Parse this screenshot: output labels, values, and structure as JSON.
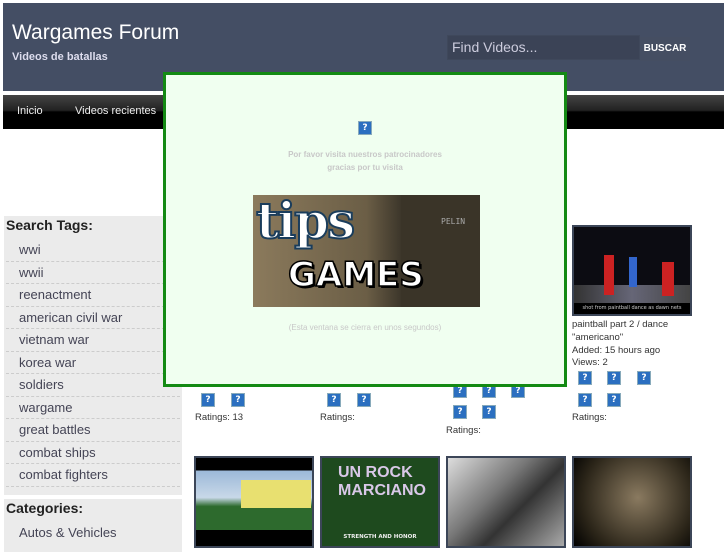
{
  "header": {
    "title": "Wargames Forum",
    "subtitle": "Videos de batallas",
    "search_placeholder": "Find Videos...",
    "search_button": "BUSCAR"
  },
  "nav": {
    "items": [
      "Inicio",
      "Videos recientes"
    ]
  },
  "sidebar": {
    "tags_title": "Search Tags:",
    "tags": [
      "wwi",
      "wwii",
      "reenactment",
      "american civil war",
      "vietnam war",
      "korea war",
      "soldiers",
      "wargame",
      "great battles",
      "combat ships",
      "combat fighters"
    ],
    "categories_title": "Categories:",
    "categories": [
      "Autos & Vehicles"
    ]
  },
  "videos": [
    {
      "ratings": "Ratings: 13"
    },
    {
      "ratings": "Ratings:"
    },
    {
      "ratings": "Ratings:"
    },
    {
      "title": "paintball part 2 / dance \"americano\"",
      "added": "Added: 15 hours ago",
      "views": "Views: 2",
      "ratings": "Ratings:",
      "caption": "shot from paintball dance as dawn nets"
    }
  ],
  "bottom_thumbs": [
    {
      "text": ""
    },
    {
      "text": "UN ROCK MARCIANO",
      "caption": "STRENGTH AND HONOR"
    },
    {
      "text": ""
    },
    {
      "text": ""
    }
  ],
  "popup": {
    "message_line1": "Por favor visita nuestros patrocinadores",
    "message_line2": "gracias por tu visita",
    "ad_text_1": "tips",
    "ad_text_2": "GAMES",
    "ad_sign": "PELIN",
    "closing_note": "(Esta ventana se cierra en unos segundos)",
    "border_color": "#138a13"
  },
  "icons": {
    "broken_image": "?"
  }
}
